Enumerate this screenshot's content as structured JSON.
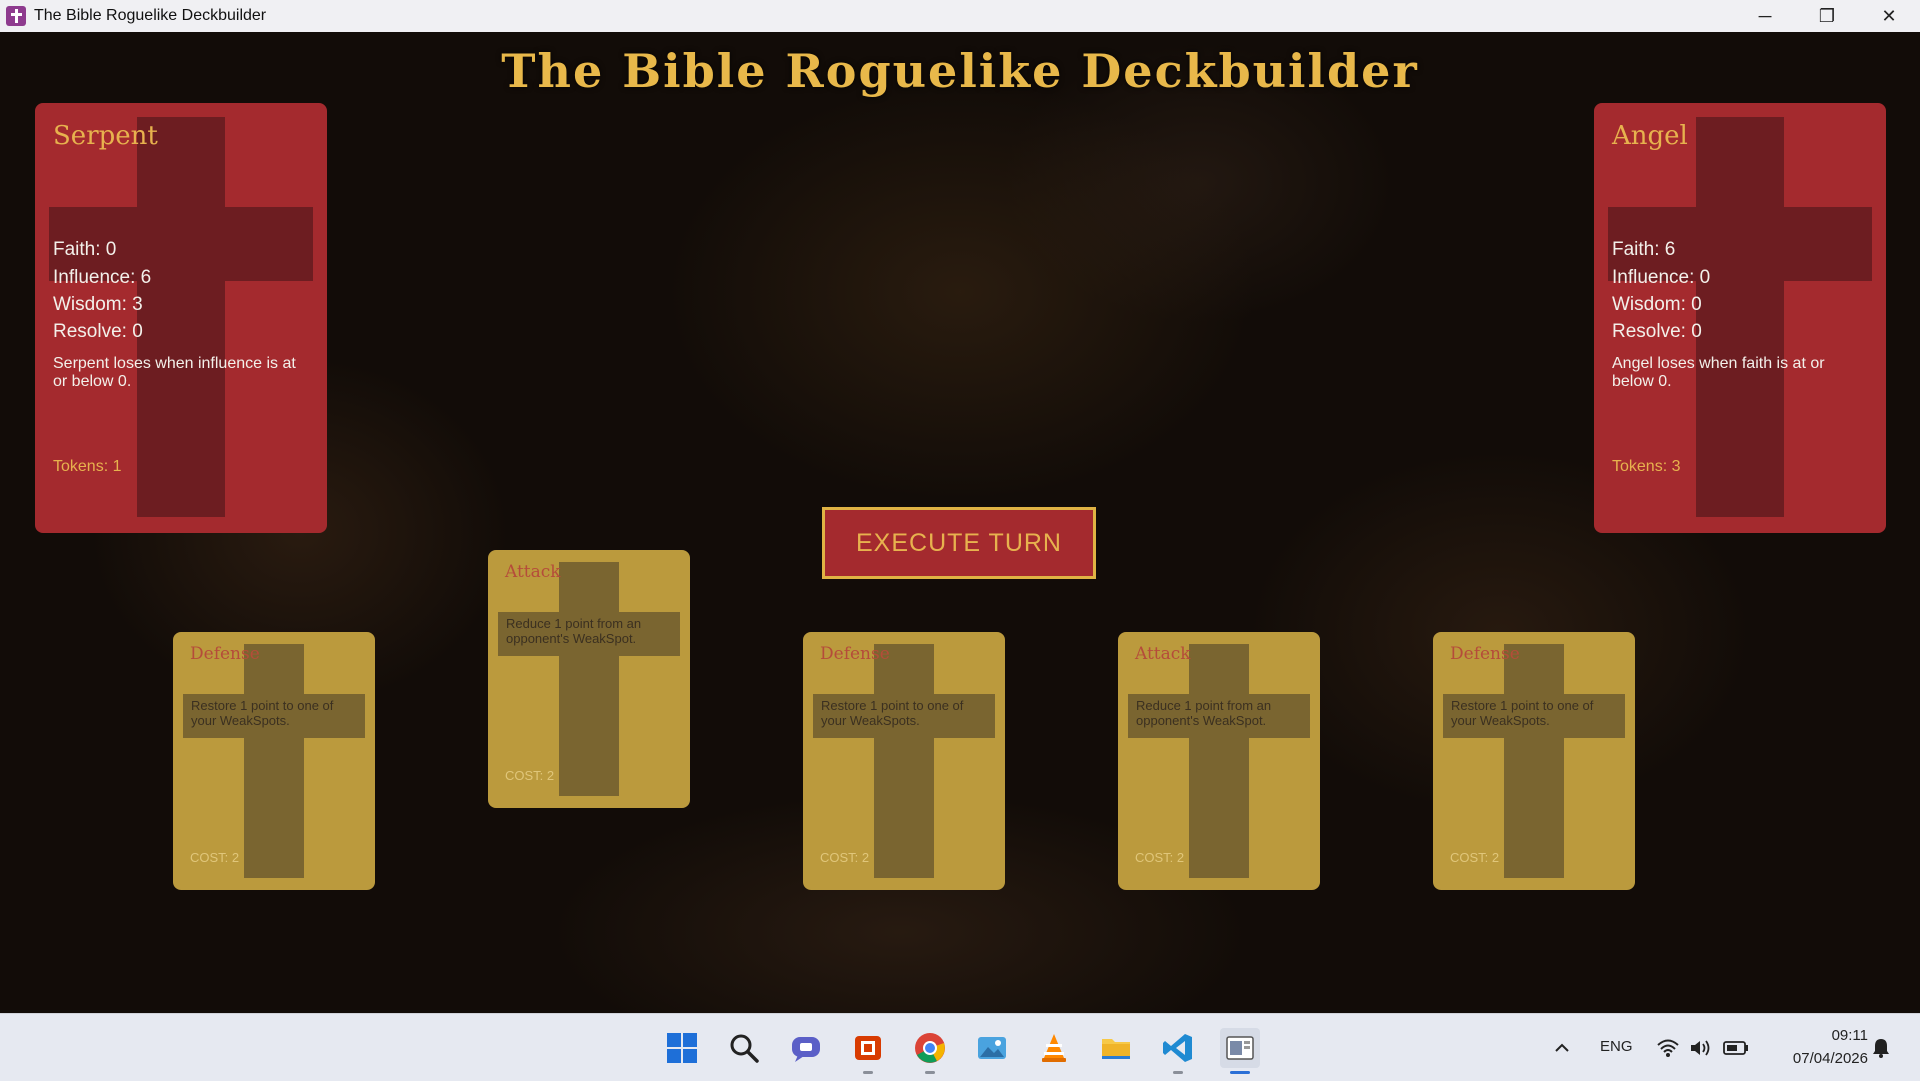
{
  "window": {
    "title": "The Bible Roguelike Deckbuilder",
    "controls": {
      "minimize": "─",
      "restore": "❐",
      "close": "✕"
    }
  },
  "game": {
    "title": "The Bible Roguelike Deckbuilder",
    "execute_button": "EXECUTE TURN"
  },
  "players": [
    {
      "name": "Serpent",
      "stats": [
        "Faith: 0",
        "Influence: 6",
        "Wisdom: 3",
        "Resolve: 0"
      ],
      "lose_condition": "Serpent loses when influence is at or below 0.",
      "tokens": "Tokens: 1"
    },
    {
      "name": "Angel",
      "stats": [
        "Faith: 6",
        "Influence: 0",
        "Wisdom: 0",
        "Resolve: 0"
      ],
      "lose_condition": "Angel loses when faith is at or below 0.",
      "tokens": "Tokens: 3"
    }
  ],
  "hand": [
    {
      "title": "Defense",
      "desc": "Restore 1 point to one of your WeakSpots.",
      "cost": "COST: 2",
      "raised": false
    },
    {
      "title": "Attack",
      "desc": "Reduce 1 point from an opponent's WeakSpot.",
      "cost": "COST: 2",
      "raised": true
    },
    {
      "title": "Defense",
      "desc": "Restore 1 point to one of your WeakSpots.",
      "cost": "COST: 2",
      "raised": false
    },
    {
      "title": "Attack",
      "desc": "Reduce 1 point from an opponent's WeakSpot.",
      "cost": "COST: 2",
      "raised": false
    },
    {
      "title": "Defense",
      "desc": "Restore 1 point to one of your WeakSpots.",
      "cost": "COST: 2",
      "raised": false
    }
  ],
  "taskbar": {
    "apps": [
      "windows-start-icon",
      "search-icon",
      "teams-chat-icon",
      "office-icon",
      "chrome-icon",
      "photos-icon",
      "vlc-icon",
      "file-explorer-icon",
      "vscode-icon",
      "game-window-icon"
    ],
    "tray": {
      "language": "ENG",
      "time": "09:11",
      "date": "07/04/2026"
    }
  },
  "colors": {
    "panel_red": "#a42a2e",
    "gold": "#e7b24e",
    "card": "#bb9a3d"
  }
}
